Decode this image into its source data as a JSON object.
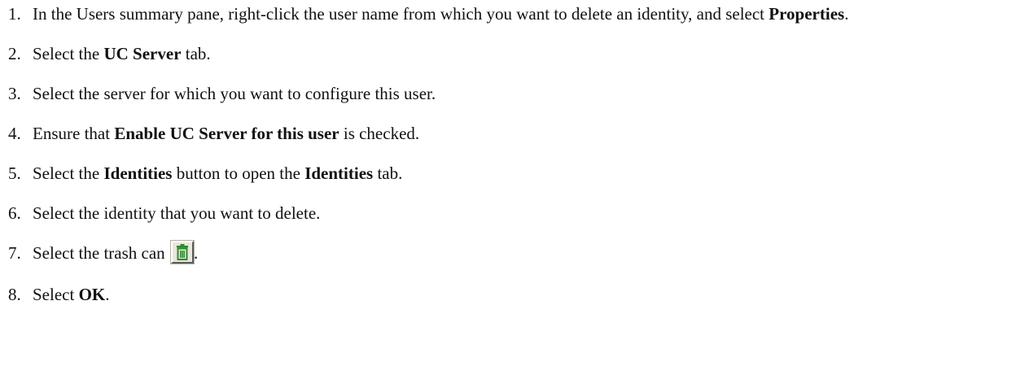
{
  "steps": [
    {
      "num": "1.",
      "parts": [
        {
          "t": "In the Users summary pane, right-click the user name from which you want to delete an identity, and select "
        },
        {
          "b": "Properties"
        },
        {
          "t": "."
        }
      ]
    },
    {
      "num": "2.",
      "parts": [
        {
          "t": "Select the "
        },
        {
          "b": "UC Server"
        },
        {
          "t": " tab."
        }
      ]
    },
    {
      "num": "3.",
      "parts": [
        {
          "t": "Select the server for which you want to configure this user."
        }
      ]
    },
    {
      "num": "4.",
      "parts": [
        {
          "t": "Ensure that "
        },
        {
          "b": "Enable UC Server for this user"
        },
        {
          "t": " is checked."
        }
      ]
    },
    {
      "num": "5.",
      "parts": [
        {
          "t": "Select the "
        },
        {
          "b": "Identities"
        },
        {
          "t": " button to open the "
        },
        {
          "b": "Identities"
        },
        {
          "t": " tab."
        }
      ]
    },
    {
      "num": "6.",
      "parts": [
        {
          "t": "Select the identity that you want to delete."
        }
      ]
    },
    {
      "num": "7.",
      "parts": [
        {
          "t": "Select the trash can "
        },
        {
          "icon": "trash-can-icon"
        },
        {
          "t": "."
        }
      ]
    },
    {
      "num": "8.",
      "parts": [
        {
          "t": "Select "
        },
        {
          "b": "OK"
        },
        {
          "t": "."
        }
      ]
    }
  ],
  "colors": {
    "text": "#111111",
    "button_face": "#e9e6dc",
    "icon_green": "#2e8b2e"
  }
}
